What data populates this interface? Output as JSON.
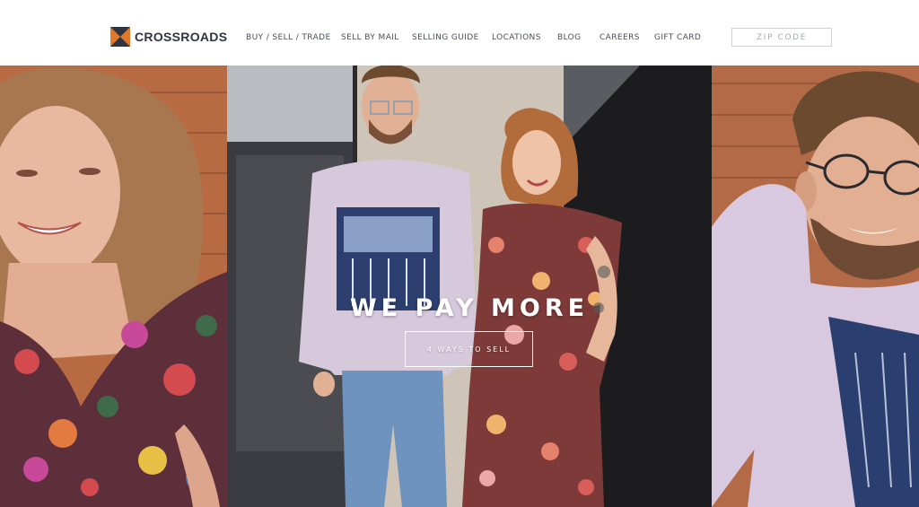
{
  "brand": {
    "name": "CROSSROADS",
    "colors": {
      "navy": "#2f3441",
      "orange": "#e07a2a"
    }
  },
  "nav": {
    "items": [
      {
        "label": "BUY / SELL / TRADE"
      },
      {
        "label": "SELL BY MAIL"
      },
      {
        "label": "SELLING GUIDE"
      },
      {
        "label": "LOCATIONS"
      },
      {
        "label": "BLOG"
      },
      {
        "label": "CAREERS"
      },
      {
        "label": "GIFT CARD"
      }
    ]
  },
  "zip": {
    "placeholder": "ZIP CODE"
  },
  "hero": {
    "title": "WE PAY MORE",
    "cta_label": "4 WAYS TO SELL",
    "images": [
      {
        "subject": "woman-floral-dress-closeup"
      },
      {
        "subject": "couple-standing-doorway"
      },
      {
        "subject": "man-glasses-sweatshirt-closeup"
      }
    ]
  }
}
